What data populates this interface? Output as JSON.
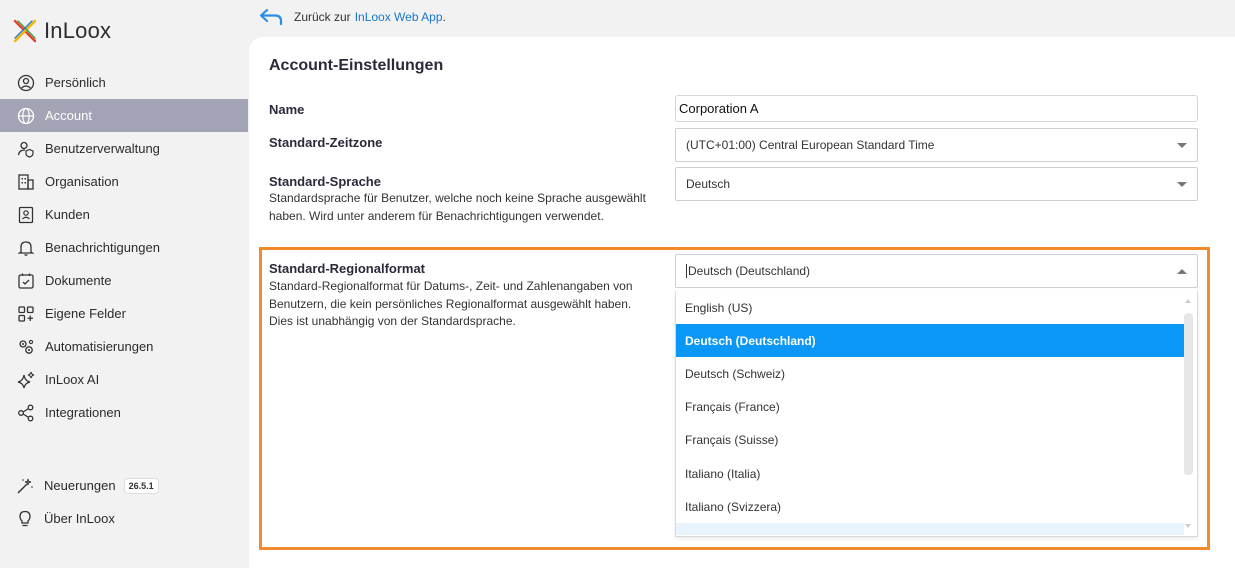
{
  "app": {
    "brand": "InLoox"
  },
  "sidebar": {
    "items": [
      {
        "label": "Persönlich",
        "icon": "user-circle-icon"
      },
      {
        "label": "Account",
        "icon": "globe-icon",
        "active": true
      },
      {
        "label": "Benutzerverwaltung",
        "icon": "user-shield-icon"
      },
      {
        "label": "Organisation",
        "icon": "building-icon"
      },
      {
        "label": "Kunden",
        "icon": "contact-card-icon"
      },
      {
        "label": "Benachrichtigungen",
        "icon": "bell-icon"
      },
      {
        "label": "Dokumente",
        "icon": "document-check-icon"
      },
      {
        "label": "Eigene Felder",
        "icon": "grid-plus-icon"
      },
      {
        "label": "Automatisierungen",
        "icon": "gears-icon"
      },
      {
        "label": "InLoox AI",
        "icon": "sparkle-icon"
      },
      {
        "label": "Integrationen",
        "icon": "share-nodes-icon"
      }
    ],
    "bottom": [
      {
        "label": "Neuerungen",
        "icon": "magic-wand-icon",
        "badge": "26.5.1"
      },
      {
        "label": "Über InLoox",
        "icon": "lightbulb-icon"
      }
    ]
  },
  "backlink": {
    "prefix": "Zurück zur",
    "link": "InLoox Web App",
    "suffix": "."
  },
  "settings": {
    "title": "Account-Einstellungen",
    "name": {
      "label": "Name",
      "value": "Corporation A"
    },
    "timezone": {
      "label": "Standard-Zeitzone",
      "value": "(UTC+01:00) Central European Standard Time"
    },
    "language": {
      "label": "Standard-Sprache",
      "description": "Standardsprache für Benutzer, welche noch keine Sprache ausgewählt haben. Wird unter anderem für Benachrichtigungen verwendet.",
      "value": "Deutsch"
    },
    "regional": {
      "label": "Standard-Regionalformat",
      "description": "Standard-Regionalformat für Datums-, Zeit- und Zahlenangaben von Benutzern, die kein persönliches Regionalformat ausgewählt haben. Dies ist unabhängig von der Standardsprache.",
      "value": "Deutsch (Deutschland)",
      "options": [
        "English (US)",
        "Deutsch (Deutschland)",
        "Deutsch (Schweiz)",
        "Français (France)",
        "Français (Suisse)",
        "Italiano (Italia)",
        "Italiano (Svizzera)"
      ],
      "selected_index": 1
    }
  },
  "colors": {
    "accent": "#0a97f5",
    "highlight": "#f28a2e",
    "sidebar_active": "#a3a3b6",
    "link": "#1877d1"
  }
}
